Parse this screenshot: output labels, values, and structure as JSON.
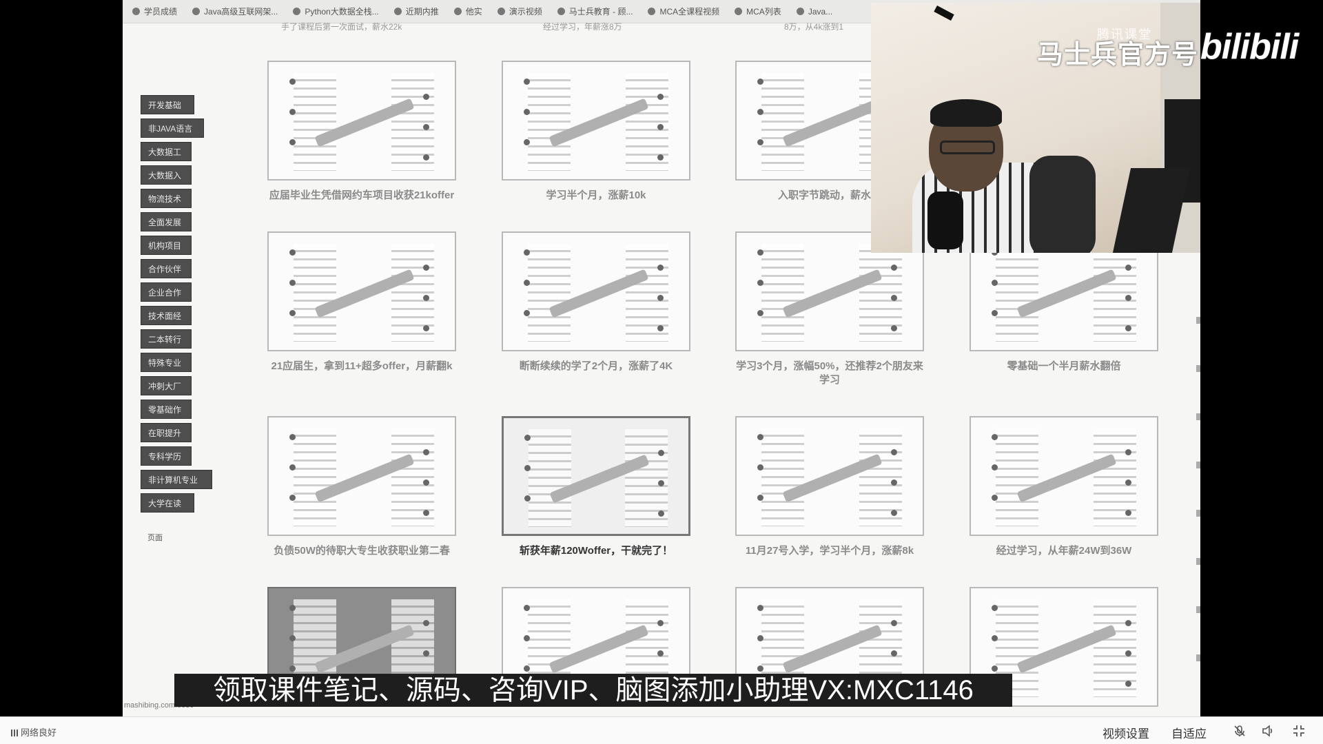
{
  "bookmarks": [
    {
      "label": "学员成绩",
      "icon": "bookmark-icon"
    },
    {
      "label": "Java高级互联网架...",
      "icon": "globe-icon"
    },
    {
      "label": "Python大数据全栈...",
      "icon": "globe-icon"
    },
    {
      "label": "近期内推",
      "icon": "refresh-icon"
    },
    {
      "label": "他实",
      "icon": "globe-icon"
    },
    {
      "label": "演示视频",
      "icon": "globe-icon"
    },
    {
      "label": "马士兵教育 - 顾...",
      "icon": "globe-icon"
    },
    {
      "label": "MCA全课程视频",
      "icon": "refresh-icon"
    },
    {
      "label": "MCA列表",
      "icon": "refresh-icon"
    },
    {
      "label": "Java...",
      "icon": "refresh-icon"
    }
  ],
  "cut_row": [
    "手了课程后第一次面试，薪水22k",
    "经过学习，年薪涨8万",
    "8万，从4k涨到1"
  ],
  "side_nav": [
    "开发基础",
    "非JAVA语言",
    "大数据工",
    "大数据入",
    "物流技术",
    "全面发展",
    "机构项目",
    "合作伙伴",
    "企业合作",
    "技术面经",
    "二本转行",
    "特殊专业",
    "冲刺大厂",
    "零基础作",
    "在职提升",
    "专科学历",
    "非计算机专业",
    "大学在读"
  ],
  "side_note": "页面",
  "cards": [
    {
      "caption": "应届毕业生凭借网约车项目收获21koffer"
    },
    {
      "caption": "学习半个月，涨薪10k"
    },
    {
      "caption": "入职字节跳动，薪水涨"
    },
    {
      "caption": "21应届生，拿到11+超多offer，月薪翻k"
    },
    {
      "caption": "断断续续的学了2个月，涨薪了4K"
    },
    {
      "caption": "学习3个月，涨幅50%，还推荐2个朋友来学习"
    },
    {
      "caption": "零基础一个半月薪水翻倍"
    },
    {
      "caption": "负债50W的待职大专生收获职业第二春"
    },
    {
      "caption": "斩获年薪120Woffer，干就完了！"
    },
    {
      "caption": "11月27号入学，学习半个月，涨薪8k"
    },
    {
      "caption": "经过学习，从年薪24W到36W"
    },
    {
      "caption": ""
    },
    {
      "caption": ""
    },
    {
      "caption": ""
    },
    {
      "caption": ""
    }
  ],
  "footer_url": "mashibing.com:8080",
  "webcam": {
    "watermark": "腾讯课堂"
  },
  "overlay": {
    "brand": "马士兵官方号",
    "platform": "bilibili"
  },
  "subtitle": "领取课件笔记、源码、咨询VIP、脑图添加小助理VX:MXC1146",
  "player": {
    "network": "网络良好",
    "settings": "视频设置",
    "adaptive": "自适应"
  }
}
